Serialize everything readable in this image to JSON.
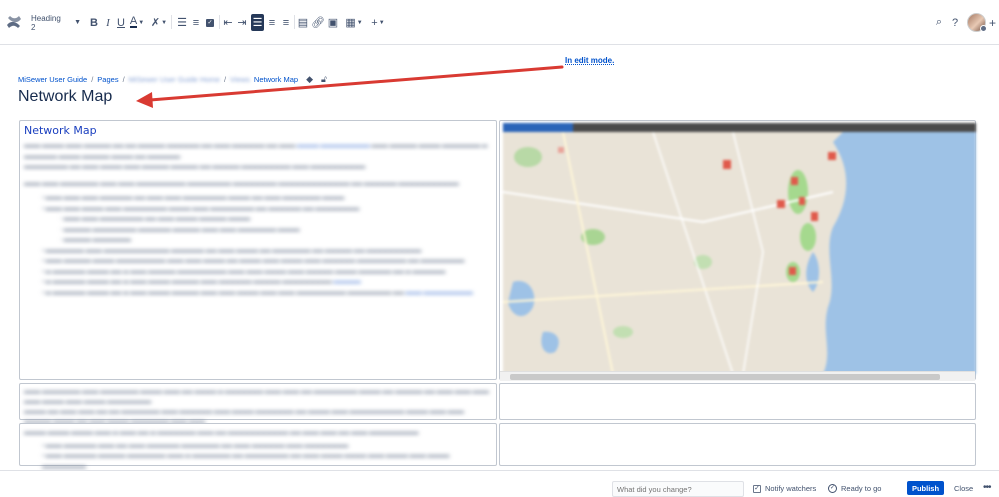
{
  "toolbar": {
    "heading_select": "Heading 2",
    "icons": [
      "bold-icon",
      "italic-icon",
      "underline-icon",
      "text-color-icon",
      "clear-format-icon",
      "bullet-list-icon",
      "numbered-list-icon",
      "task-list-icon",
      "outdent-icon",
      "indent-icon",
      "align-left-icon",
      "align-center-icon",
      "align-right-icon",
      "layout-icon",
      "link-icon",
      "image-icon",
      "table-icon",
      "insert-more-icon",
      "search-icon",
      "help-icon"
    ]
  },
  "breadcrumb": {
    "items": [
      "MiSewer User Guide",
      "Pages",
      "Network Map"
    ],
    "blurred_items": [
      "MiSewer User Guide Home",
      "Views"
    ]
  },
  "edit_note": "In edit mode.",
  "page": {
    "title": "Network Map"
  },
  "content": {
    "cell_title": "Network Map"
  },
  "bottom": {
    "comment_placeholder": "What did you change?",
    "notify_watchers": "Notify watchers",
    "ready_to_go": "Ready to go",
    "publish": "Publish",
    "close": "Close"
  },
  "colors": {
    "accent": "#0052cc",
    "arrow": "#d93a32",
    "active_toolbar": "#253858"
  }
}
